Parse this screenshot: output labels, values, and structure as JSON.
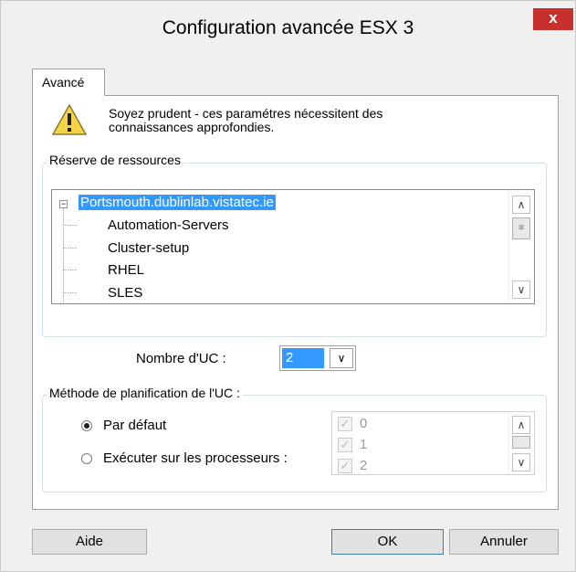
{
  "window": {
    "title": "Configuration avancée ESX 3",
    "close_glyph": "x",
    "close_color": "#c7302b"
  },
  "tabs": [
    {
      "label": "Avancé",
      "active": true
    }
  ],
  "warning": {
    "icon": "warning-triangle-icon",
    "text_line1": "Soyez prudent - ces paramétres nécessitent des",
    "text_line2": "connaissances approfondies."
  },
  "resource_group": {
    "label": "Réserve de ressources",
    "root": {
      "label": "Portsmouth.dublinlab.vistatec.ie",
      "selected": true,
      "expander": "−"
    },
    "children": [
      "Automation-Servers",
      "Cluster-setup",
      "RHEL",
      "SLES"
    ]
  },
  "cpu_count": {
    "label": "Nombre d'UC :",
    "value": "2"
  },
  "scheduling_group": {
    "label": "Méthode de planification de l'UC :",
    "options": [
      {
        "label": "Par défaut",
        "selected": true
      },
      {
        "label": "Exécuter sur les processeurs :",
        "selected": false
      }
    ],
    "processors": [
      {
        "label": "0",
        "checked": true,
        "disabled": true
      },
      {
        "label": "1",
        "checked": true,
        "disabled": true
      },
      {
        "label": "2",
        "checked": true,
        "disabled": true
      }
    ]
  },
  "buttons": {
    "help": "Aide",
    "ok": "OK",
    "cancel": "Annuler"
  },
  "colors": {
    "selection": "#3399ff",
    "dialog_bg": "#f0f0f0"
  }
}
